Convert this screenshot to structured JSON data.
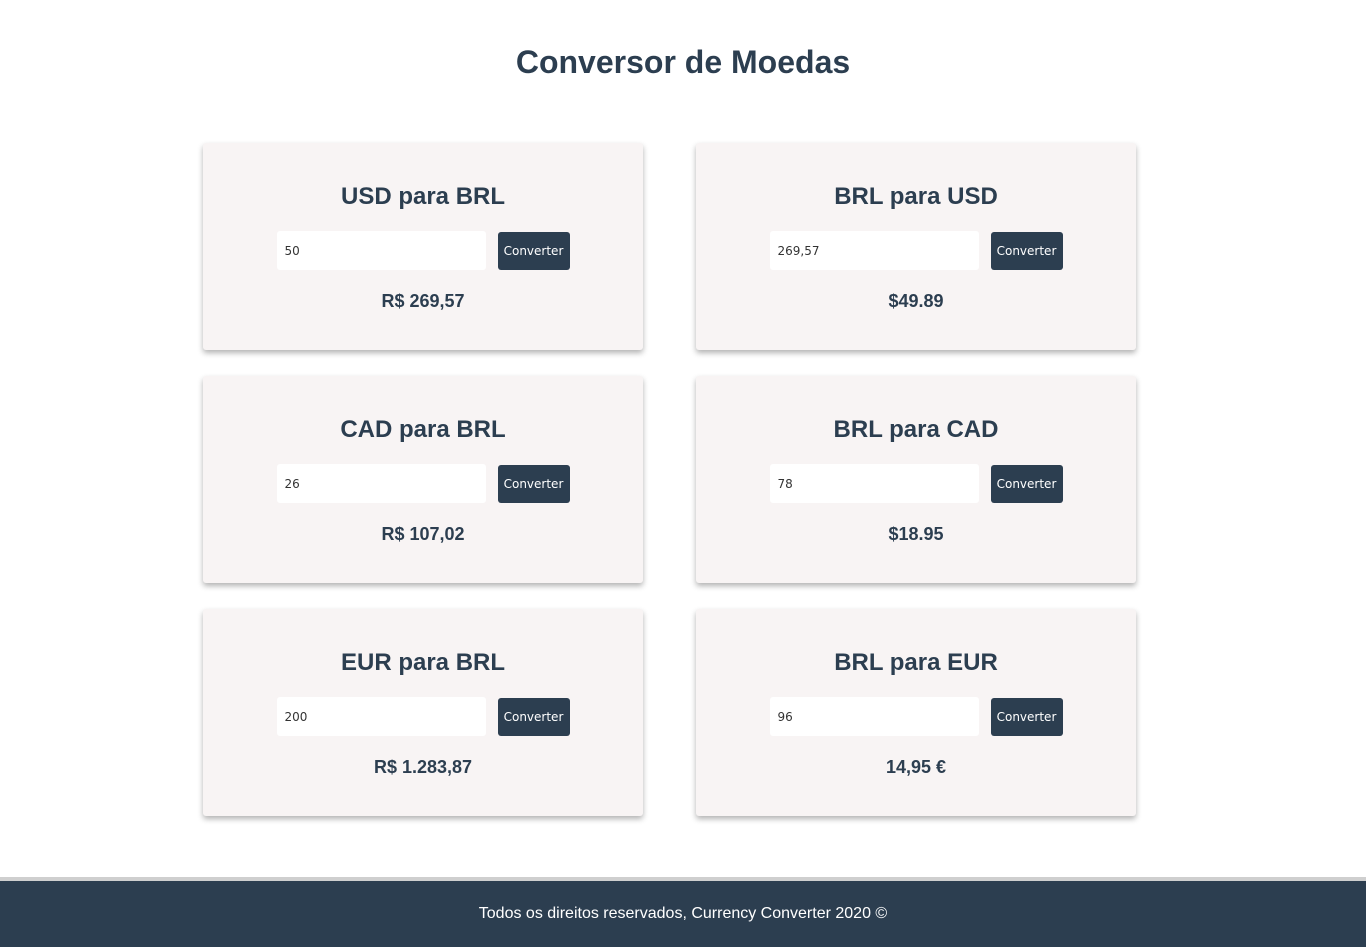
{
  "header": {
    "title": "Conversor de Moedas"
  },
  "colors": {
    "primary": "#2c3e50",
    "card_bg": "#f8f4f4",
    "footer_border": "#cfcfcf"
  },
  "converters": [
    {
      "title": "USD para BRL",
      "input_value": "50",
      "button_label": "Converter",
      "result": "R$ 269,57"
    },
    {
      "title": "BRL para USD",
      "input_value": "269,57",
      "button_label": "Converter",
      "result": "$49.89"
    },
    {
      "title": "CAD para BRL",
      "input_value": "26",
      "button_label": "Converter",
      "result": "R$ 107,02"
    },
    {
      "title": "BRL para CAD",
      "input_value": "78",
      "button_label": "Converter",
      "result": "$18.95"
    },
    {
      "title": "EUR para BRL",
      "input_value": "200",
      "button_label": "Converter",
      "result": "R$ 1.283,87"
    },
    {
      "title": "BRL para EUR",
      "input_value": "96",
      "button_label": "Converter",
      "result": "14,95 €"
    }
  ],
  "footer": {
    "text": "Todos os direitos reservados, Currency Converter 2020 ©"
  }
}
